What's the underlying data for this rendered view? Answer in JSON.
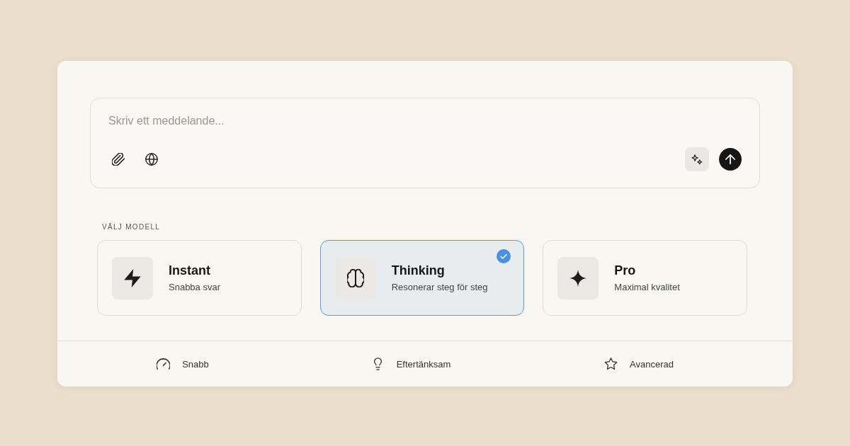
{
  "composer": {
    "placeholder": "Skriv ett meddelande..."
  },
  "model_picker": {
    "label": "VÄLJ MODELL",
    "models": [
      {
        "name": "Instant",
        "description": "Snabba svar",
        "selected": false
      },
      {
        "name": "Thinking",
        "description": "Resonerar steg för steg",
        "selected": true
      },
      {
        "name": "Pro",
        "description": "Maximal kvalitet",
        "selected": false
      }
    ]
  },
  "footer": {
    "items": [
      {
        "label": "Snabb"
      },
      {
        "label": "Eftertänksam"
      },
      {
        "label": "Avancerad"
      }
    ]
  }
}
